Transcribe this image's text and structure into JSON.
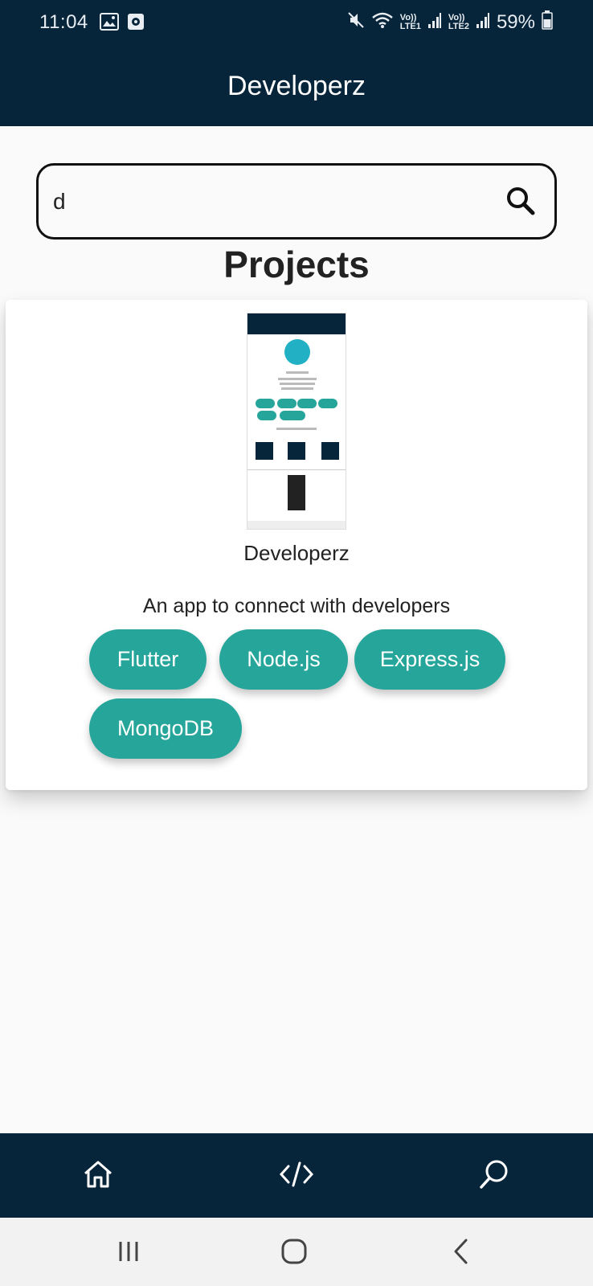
{
  "status_bar": {
    "time": "11:04",
    "sim1": {
      "top": "Vo))",
      "bottom": "LTE1"
    },
    "sim2": {
      "top": "Vo))",
      "bottom": "LTE2"
    },
    "battery": "59%",
    "icons": [
      "image-icon",
      "screen-record-icon",
      "mute-icon",
      "wifi-icon",
      "signal-icon",
      "battery-icon"
    ]
  },
  "app_bar": {
    "title": "Developerz"
  },
  "search": {
    "value": "d",
    "icon": "search-icon"
  },
  "section": {
    "title": "Projects"
  },
  "project": {
    "name": "Developerz",
    "description": "An app to connect with developers",
    "tags": [
      "Flutter",
      "Node.js",
      "Express.js",
      "MongoDB"
    ]
  },
  "bottom_nav": {
    "items": [
      "home-icon",
      "code-icon",
      "search-icon"
    ]
  },
  "system_nav": {
    "items": [
      "recents-icon",
      "home-circle-icon",
      "back-icon"
    ]
  },
  "colors": {
    "primary_dark": "#06243a",
    "chip": "#26a69a",
    "background": "#fafafa",
    "card": "#ffffff"
  }
}
